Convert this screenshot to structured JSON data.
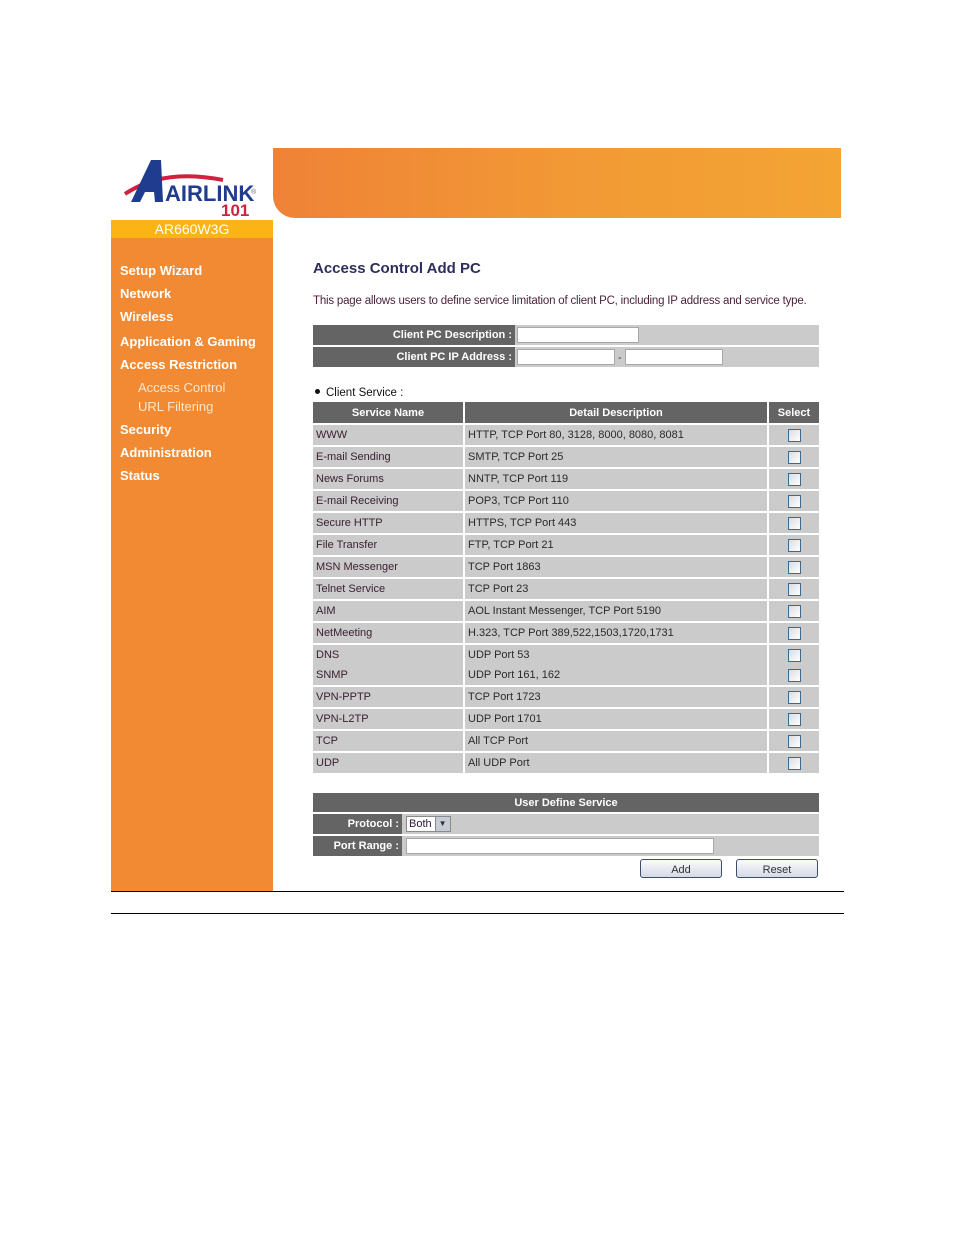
{
  "brand": {
    "logo_text": "AIRLINK",
    "logo_number": "101",
    "model": "AR660W3G",
    "colors": {
      "sidebar": "#f28a33",
      "model_bar": "#fbb415",
      "header_cell": "#646464",
      "row_bg": "#cbcbcb"
    }
  },
  "sidebar": {
    "items": [
      {
        "label": "Setup Wizard",
        "type": "main"
      },
      {
        "label": "Network",
        "type": "main"
      },
      {
        "label": "Wireless",
        "type": "main"
      },
      {
        "label": "Application & Gaming",
        "type": "main"
      },
      {
        "label": "Access Restriction",
        "type": "main"
      },
      {
        "label": "Access Control",
        "type": "sub"
      },
      {
        "label": "URL Filtering",
        "type": "sub"
      },
      {
        "label": "Security",
        "type": "main"
      },
      {
        "label": "Administration",
        "type": "main"
      },
      {
        "label": "Status",
        "type": "main"
      }
    ]
  },
  "main": {
    "title": "Access Control Add PC",
    "description": "This page allows users to define service limitation of client PC, including IP address and service type.",
    "client_form": {
      "description_label": "Client PC Description :",
      "description_value": "",
      "ip_label": "Client PC IP Address :",
      "ip_start_value": "",
      "ip_separator": "-",
      "ip_end_value": ""
    },
    "client_service": {
      "label": "Client Service :",
      "columns": [
        "Service Name",
        "Detail Description",
        "Select"
      ],
      "rows": [
        {
          "name": "WWW",
          "detail": "HTTP, TCP Port 80, 3128, 8000, 8080, 8081",
          "selected": false
        },
        {
          "name": "E-mail Sending",
          "detail": "SMTP, TCP Port 25",
          "selected": false
        },
        {
          "name": "News Forums",
          "detail": "NNTP, TCP Port 119",
          "selected": false
        },
        {
          "name": "E-mail Receiving",
          "detail": "POP3, TCP Port 110",
          "selected": false
        },
        {
          "name": "Secure HTTP",
          "detail": "HTTPS, TCP Port 443",
          "selected": false
        },
        {
          "name": "File Transfer",
          "detail": "FTP, TCP Port 21",
          "selected": false
        },
        {
          "name": "MSN Messenger",
          "detail": "TCP Port 1863",
          "selected": false
        },
        {
          "name": "Telnet Service",
          "detail": "TCP Port 23",
          "selected": false
        },
        {
          "name": "AIM",
          "detail": "AOL Instant Messenger, TCP Port 5190",
          "selected": false
        },
        {
          "name": "NetMeeting",
          "detail": "H.323, TCP Port 389,522,1503,1720,1731",
          "selected": false
        },
        {
          "name": "DNS",
          "detail": "UDP Port 53",
          "selected": false
        },
        {
          "name": "SNMP",
          "detail": "UDP Port 161, 162",
          "selected": false
        },
        {
          "name": "VPN-PPTP",
          "detail": "TCP Port 1723",
          "selected": false
        },
        {
          "name": "VPN-L2TP",
          "detail": "UDP Port 1701",
          "selected": false
        },
        {
          "name": "TCP",
          "detail": "All TCP Port",
          "selected": false
        },
        {
          "name": "UDP",
          "detail": "All UDP Port",
          "selected": false
        }
      ]
    },
    "user_define_service": {
      "title": "User Define Service",
      "protocol_label": "Protocol :",
      "protocol_value": "Both",
      "port_range_label": "Port Range :",
      "port_range_value": "",
      "add_label": "Add",
      "reset_label": "Reset"
    }
  }
}
